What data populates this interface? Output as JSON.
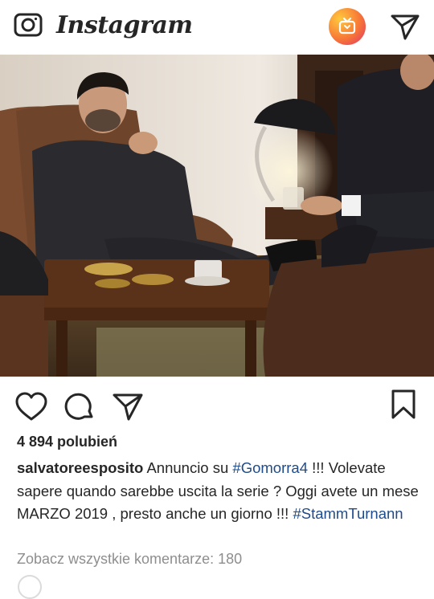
{
  "header": {
    "brand": "Instagram",
    "camera_icon": "camera-icon",
    "igtv_icon": "igtv-icon",
    "direct_icon": "paper-plane-icon"
  },
  "post": {
    "image_alt_icon": "post-photo",
    "actions": {
      "like_icon": "heart-icon",
      "comment_icon": "comment-bubble-icon",
      "share_icon": "paper-plane-icon",
      "save_icon": "bookmark-icon"
    },
    "likes": "4 894 polubień",
    "caption": {
      "username": "salvatoreesposito",
      "text_1": " Annuncio su ",
      "tag_1": "#Gomorra4",
      "text_2": " !!! Volevate sapere quando sarebbe uscita la serie ? Oggi avete un mese MARZO 2019 , presto anche un giorno !!! ",
      "tag_2": "#StammTurnann"
    },
    "view_comments": "Zobacz wszystkie komentarze: 180"
  },
  "colors": {
    "text": "#262626",
    "hashtag": "#1f4b8a",
    "muted": "#8e8e8e",
    "igtv_gradient_start": "#ffc93c",
    "igtv_gradient_end": "#e1306c"
  }
}
